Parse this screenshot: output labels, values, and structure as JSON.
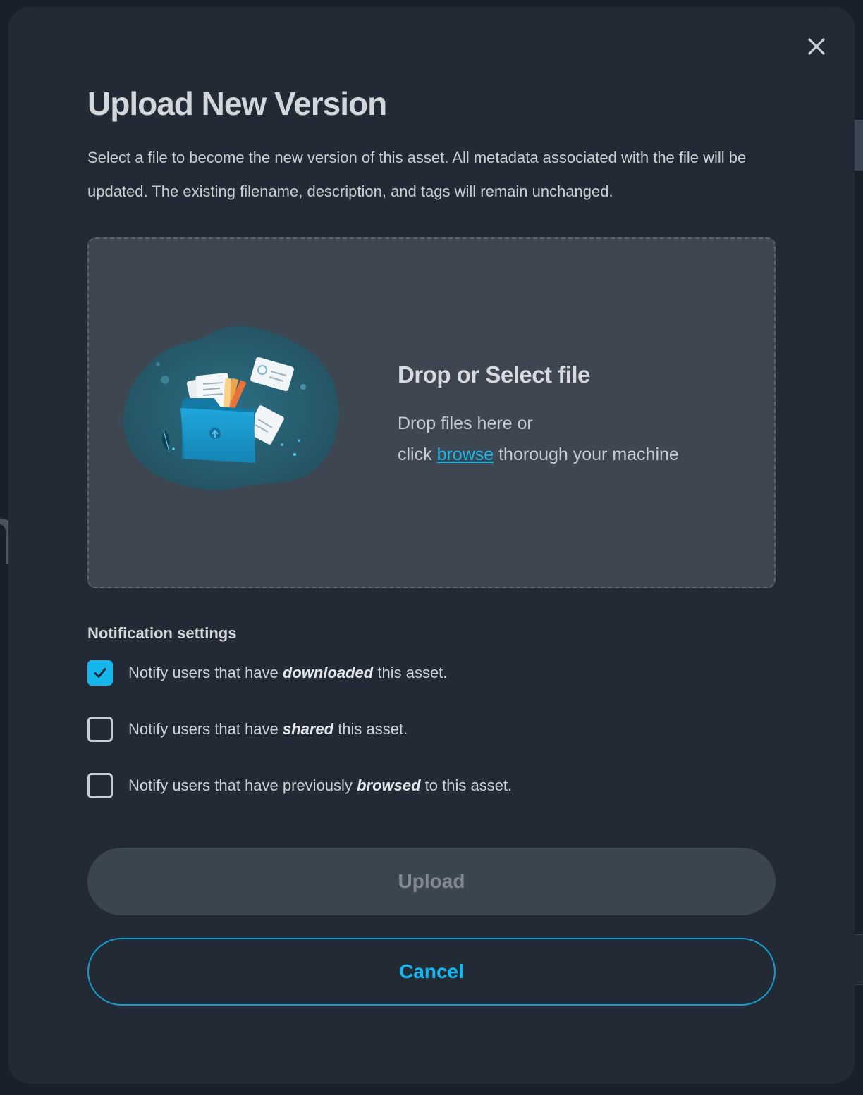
{
  "modal": {
    "title": "Upload New Version",
    "description": "Select a file to become the new version of this asset. All metadata associated with the file will be updated. The existing filename, description, and tags will remain unchanged.",
    "close_icon": "close-icon"
  },
  "dropzone": {
    "title": "Drop or Select file",
    "line1": "Drop files here or",
    "line2_prefix": "click",
    "browse_label": "browse",
    "line2_suffix": "thorough your machine",
    "illustration_icon": "folder-upload-illustration"
  },
  "notifications": {
    "heading": "Notification settings",
    "options": [
      {
        "prefix": "Notify users that have",
        "emphasis": "downloaded",
        "suffix": "this asset.",
        "checked": true
      },
      {
        "prefix": "Notify users that have",
        "emphasis": "shared",
        "suffix": "this asset.",
        "checked": false
      },
      {
        "prefix": "Notify users that have previously",
        "emphasis": "browsed",
        "suffix": "to this asset.",
        "checked": false
      }
    ]
  },
  "actions": {
    "upload_label": "Upload",
    "cancel_label": "Cancel"
  },
  "colors": {
    "accent": "#15b6ec",
    "modal_bg": "#212a35",
    "dropzone_bg": "#3e4651",
    "upload_disabled_bg": "#3b4550"
  }
}
